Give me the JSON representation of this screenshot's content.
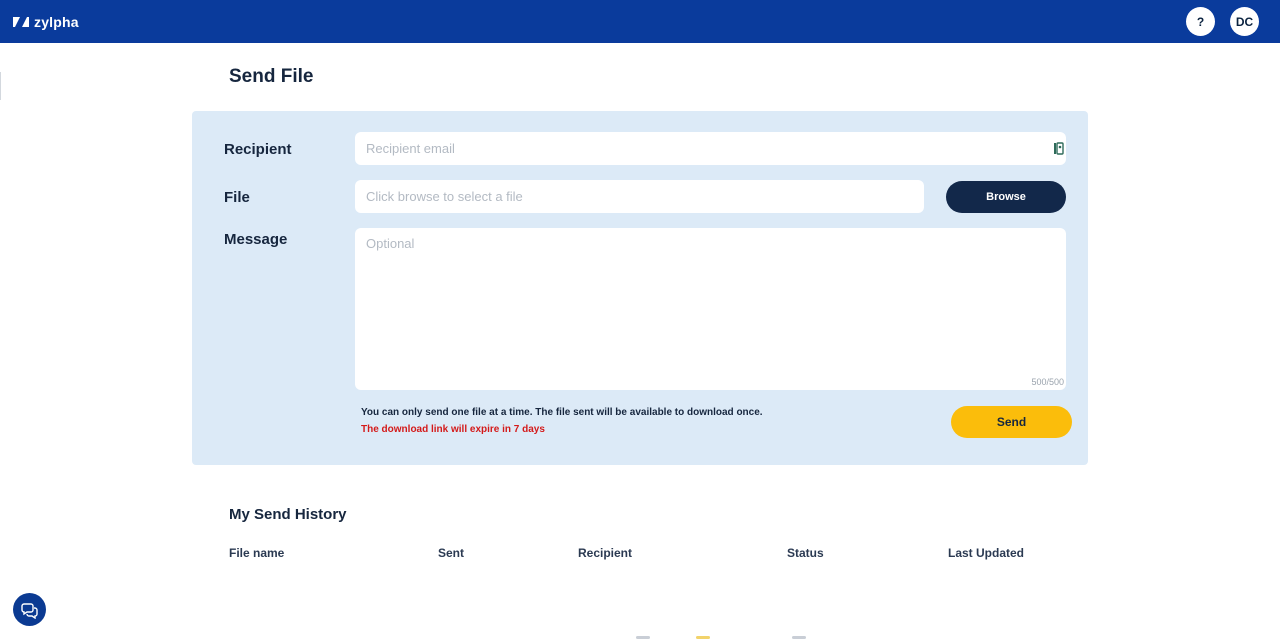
{
  "header": {
    "logo_text": "zylpha",
    "help_label": "?",
    "avatar_initials": "DC"
  },
  "page": {
    "title": "Send File"
  },
  "form": {
    "recipient_label": "Recipient",
    "recipient_placeholder": "Recipient email",
    "file_label": "File",
    "file_placeholder": "Click browse to select a file",
    "browse_label": "Browse",
    "message_label": "Message",
    "message_placeholder": "Optional",
    "char_count": "500/500",
    "note": "You can only send one file at a time. The file sent will be available to download once.",
    "expire_note": "The download link will expire in 7 days",
    "send_label": "Send"
  },
  "history": {
    "title": "My Send History",
    "columns": [
      "File name",
      "Sent",
      "Recipient",
      "Status",
      "Last Updated"
    ]
  },
  "colors": {
    "topbar": "#0a3b9c",
    "card": "#dceaf7",
    "browse_button": "#12284a",
    "send_button": "#fbbd0b",
    "expire_text": "#d41a1a"
  },
  "icons": {
    "logo": "zylpha-logo-icon",
    "contact": "contact-card-icon",
    "chat": "chat-bubbles-icon"
  }
}
